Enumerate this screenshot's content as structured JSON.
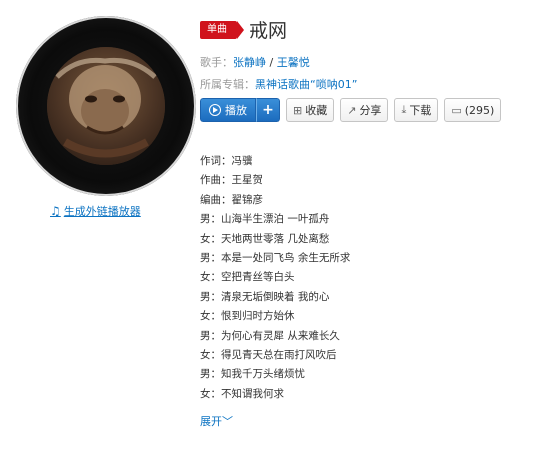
{
  "song": {
    "badge": "单曲",
    "title": "戒网",
    "singer_label": "歌手：",
    "singer_1": "张静峥",
    "singer_sep": " / ",
    "singer_2": "王馨悦",
    "album_label": "所属专辑：",
    "album": "黑神话歌曲“唢呐01”"
  },
  "actions": {
    "play": "播放",
    "add": "+",
    "collect": "收藏",
    "share": "分享",
    "download": "下载",
    "comments": "(295)"
  },
  "outlink": "生成外链播放器",
  "lyrics": [
    "作词：冯骥",
    "作曲：王星贺",
    "编曲：翟锦彦",
    "男：山海半生漂泊 一叶孤舟",
    "女：天地两世零落 几处离愁",
    "男：本是一处同飞鸟 余生无所求",
    "女：空把青丝等白头",
    "男：清泉无垢倒映着 我的心",
    "女：恨到归时方始休",
    "男：为何心有灵犀 从来难长久",
    "女：得见青天总在雨打风吹后",
    "男：知我千万头绪烦忧",
    "女：不知谓我何求"
  ],
  "expand": "展开"
}
